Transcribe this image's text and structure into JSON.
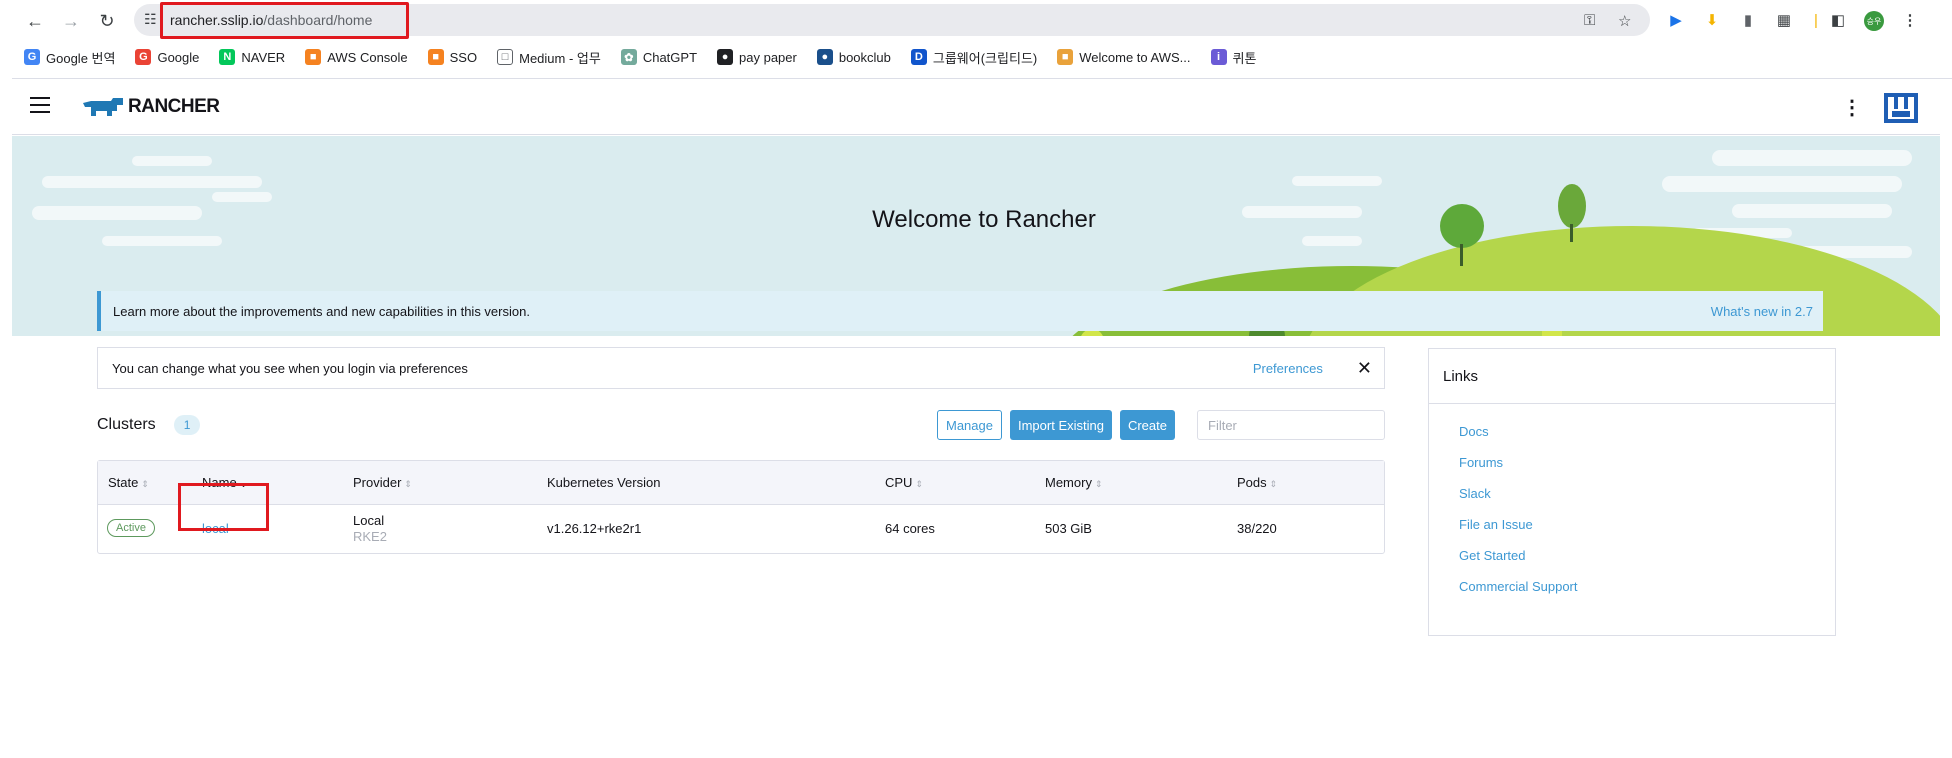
{
  "browser": {
    "url_host": "rancher.sslip.io",
    "url_path": "/dashboard/home",
    "avatar_text": "승우",
    "bookmarks": [
      {
        "label": "Google 번역",
        "icon": "translate-icon",
        "color": "#4285f4",
        "glyph": "G"
      },
      {
        "label": "Google",
        "icon": "google-icon",
        "color": "#ea4335",
        "glyph": "G"
      },
      {
        "label": "NAVER",
        "icon": "naver-icon",
        "color": "#03c75a",
        "glyph": "N"
      },
      {
        "label": "AWS Console",
        "icon": "aws-cube-icon",
        "color": "#f58220",
        "glyph": "■"
      },
      {
        "label": "SSO",
        "icon": "aws-cube-icon",
        "color": "#f58220",
        "glyph": "■"
      },
      {
        "label": "Medium - 업무",
        "icon": "folder-icon",
        "color": "#ffffff",
        "glyph": "□"
      },
      {
        "label": "ChatGPT",
        "icon": "chatgpt-icon",
        "color": "#74aa9c",
        "glyph": "✿"
      },
      {
        "label": "pay paper",
        "icon": "globe-icon",
        "color": "#202124",
        "glyph": "●"
      },
      {
        "label": "bookclub",
        "icon": "bookclub-icon",
        "color": "#1a4f8b",
        "glyph": "●"
      },
      {
        "label": "그룹웨어(크립티드)",
        "icon": "groupware-icon",
        "color": "#1155cc",
        "glyph": "D"
      },
      {
        "label": "Welcome to AWS...",
        "icon": "aws-box-icon",
        "color": "#e9a23b",
        "glyph": "■"
      },
      {
        "label": "퀴톤",
        "icon": "info-icon",
        "color": "#6b5bd6",
        "glyph": "i"
      }
    ]
  },
  "app": {
    "brand": "RANCHER",
    "colors": {
      "accent": "#3d98d3",
      "active": "#5d995d",
      "highlight": "#e0191f"
    }
  },
  "banner": {
    "title": "Welcome to Rancher"
  },
  "learn": {
    "text": "Learn more about the improvements and new capabilities in this version.",
    "link": "What's new in 2.7"
  },
  "prefs": {
    "text": "You can change what you see when you login via preferences",
    "link": "Preferences"
  },
  "clusters": {
    "title": "Clusters",
    "count": "1",
    "manage": "Manage",
    "import": "Import Existing",
    "create": "Create",
    "filter_placeholder": "Filter",
    "columns": [
      "State",
      "Name",
      "Provider",
      "Kubernetes Version",
      "CPU",
      "Memory",
      "Pods"
    ],
    "rows": [
      {
        "state": "Active",
        "name": "local",
        "provider": "Local",
        "provider_sub": "RKE2",
        "version": "v1.26.12+rke2r1",
        "cpu": "64 cores",
        "memory": "503 GiB",
        "pods": "38/220"
      }
    ]
  },
  "links": {
    "title": "Links",
    "items": [
      "Docs",
      "Forums",
      "Slack",
      "File an Issue",
      "Get Started",
      "Commercial Support"
    ]
  }
}
